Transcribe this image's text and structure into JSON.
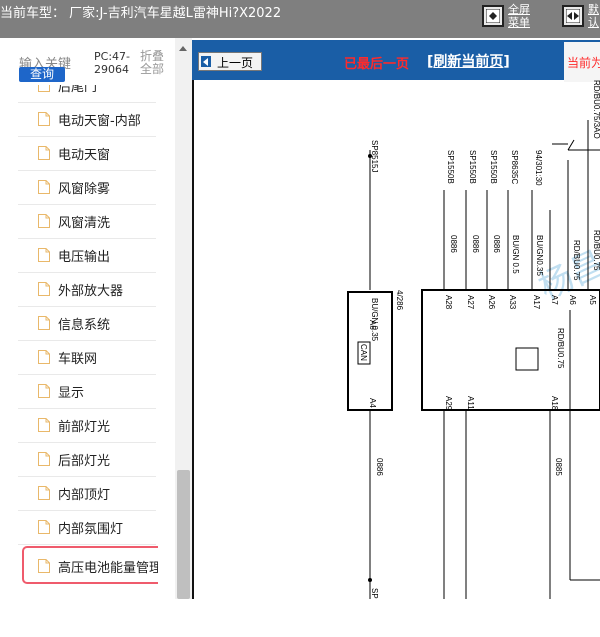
{
  "topbar": {
    "title": "当前车型： 厂家:J-吉利汽车星越L雷神Hi?X2022",
    "fullscreen": [
      "全屏",
      "菜单"
    ],
    "second_button": [
      "默",
      "认"
    ]
  },
  "sidebar": {
    "search_label": "输入关键",
    "search_button": "查询",
    "pc_code": "PC:47-29064",
    "collapse_all": "折叠全部",
    "items": [
      {
        "label": "后尾门"
      },
      {
        "label": "电动天窗-内部"
      },
      {
        "label": "电动天窗"
      },
      {
        "label": "风窗除雾"
      },
      {
        "label": "风窗清洗"
      },
      {
        "label": "电压输出"
      },
      {
        "label": "外部放大器"
      },
      {
        "label": "信息系统"
      },
      {
        "label": "车联网"
      },
      {
        "label": "显示"
      },
      {
        "label": "前部灯光"
      },
      {
        "label": "后部灯光"
      },
      {
        "label": "内部顶灯"
      },
      {
        "label": "内部氛围灯"
      },
      {
        "label": "高压电池能量管理",
        "selected": true
      }
    ]
  },
  "viewer": {
    "prev_page": "上一页",
    "last_page_notice": "已最后一页",
    "refresh": "刷新当前页",
    "current_page": "当前为",
    "diagram": {
      "wire_codes": [
        "SP1550B",
        "SP1550B",
        "SP1550B",
        "SP8635C",
        "94/301:30",
        "RD/BU0.75/3AO"
      ],
      "sp_left": "SP8515J",
      "connector_left": "4/286",
      "wire_left": "BU/GN 0.35",
      "pin_left_top": "A6",
      "pin_left_bottom": "A4",
      "can_label": "CAN",
      "pins_top": [
        "A28",
        "A27",
        "A26",
        "A33",
        "A17",
        "A7",
        "A6",
        "A5"
      ],
      "pins_bottom": [
        "A29",
        "A11",
        "A18"
      ],
      "vertical_wires": [
        "BU/GN 0.5",
        "BU/GN0.35",
        "RD/BU0.75",
        "RD/BU0.75"
      ],
      "module_wire": "RD/BU0.75",
      "mid_code": "0886",
      "bottom_code": "0885",
      "left_bottom_code": "0886",
      "sp_bottom": "SP",
      "watermark": "杨昌"
    }
  }
}
